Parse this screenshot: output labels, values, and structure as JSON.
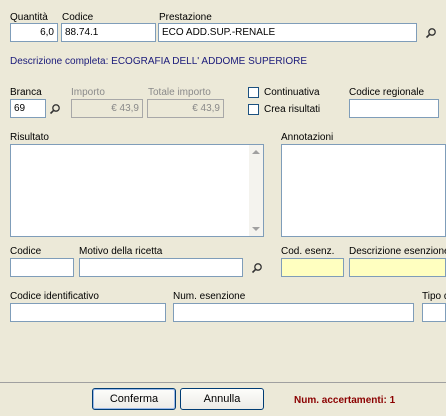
{
  "header_row": {
    "quantita_label": "Quantità",
    "quantita_value": "6,0",
    "codice_label": "Codice",
    "codice_value": "88.74.1",
    "prestazione_label": "Prestazione",
    "prestazione_value": "ECO ADD.SUP.-RENALE"
  },
  "descrizione_completa": "Descrizione completa: ECOGRAFIA DELL' ADDOME SUPERIORE",
  "row2": {
    "branca_label": "Branca",
    "branca_value": "69",
    "importo_label": "Importo",
    "importo_value": "€ 43,9",
    "totale_label": "Totale importo",
    "totale_value": "€ 43,9",
    "continuativa_label": "Continuativa",
    "crea_risultati_label": "Crea risultati",
    "codice_regionale_label": "Codice regionale",
    "codice_regionale_value": ""
  },
  "risultato_label": "Risultato",
  "annotazioni_label": "Annotazioni",
  "row3": {
    "codice_label": "Codice",
    "motivo_label": "Motivo della ricetta",
    "cod_esenz_label": "Cod. esenz.",
    "descr_esenzione_label": "Descrizione esenzione"
  },
  "row4": {
    "codice_identificativo_label": "Codice identificativo",
    "num_esenzione_label": "Num. esenzione",
    "tipo_label": "Tipo d"
  },
  "footer": {
    "conferma_label": "Conferma",
    "annulla_label": "Annulla",
    "status_text": "Num. accertamenti: 1"
  },
  "colors": {
    "panel": "#ece9d8",
    "field_border": "#7f9db9",
    "exemption_field": "#ffffc0",
    "status_text": "#8b0000"
  },
  "icons": [
    "search-lens-icon"
  ]
}
